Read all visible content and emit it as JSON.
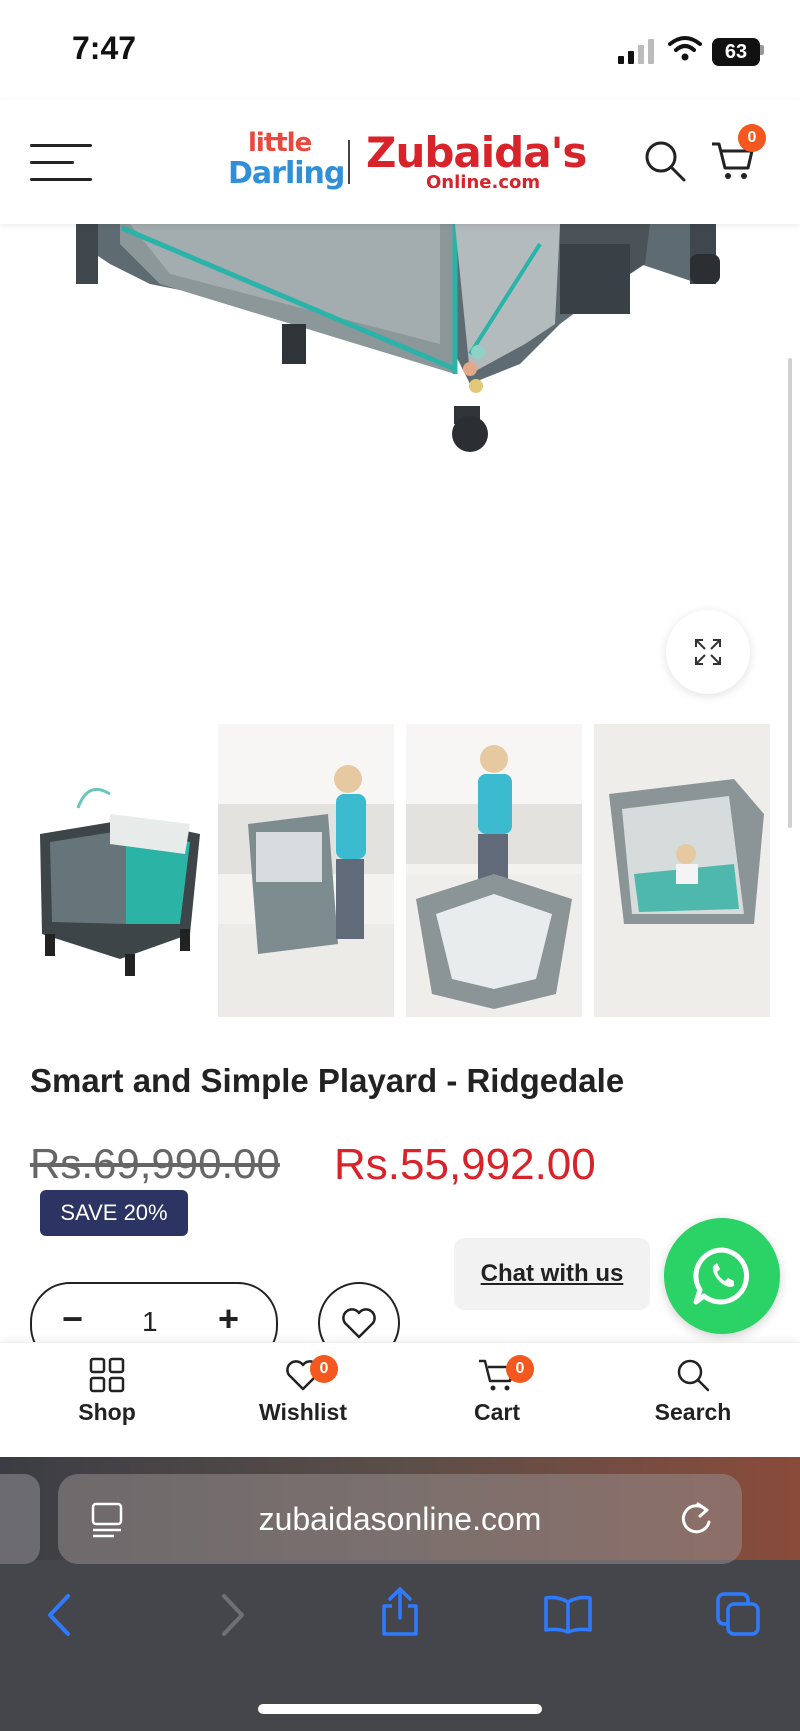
{
  "status_bar": {
    "time": "7:47",
    "battery": "63"
  },
  "header": {
    "logo_left_line1": "little",
    "logo_left_line2": "Darling",
    "logo_right_main": "Zubaida's",
    "logo_right_sub": "Online.com",
    "cart_count": "0"
  },
  "product": {
    "title": "Smart and Simple Playard - Ridgedale",
    "old_price": "Rs.69,990.00",
    "new_price": "Rs.55,992.00",
    "save_badge": "SAVE 20%",
    "quantity": "1",
    "qty_minus": "−",
    "qty_plus": "+"
  },
  "chat": {
    "label": "Chat with us"
  },
  "bottom_nav": {
    "items": [
      {
        "label": "Shop",
        "icon": "grid-icon"
      },
      {
        "label": "Wishlist",
        "icon": "heart-icon",
        "badge": "0"
      },
      {
        "label": "Cart",
        "icon": "cart-icon",
        "badge": "0"
      },
      {
        "label": "Search",
        "icon": "search-icon"
      }
    ]
  },
  "browser": {
    "url": "zubaidasonline.com"
  },
  "colors": {
    "accent_red": "#d8232a",
    "badge_orange": "#f4581e",
    "save_navy": "#2b3462",
    "whatsapp_green": "#2bd366",
    "ios_blue": "#2f7bff"
  }
}
